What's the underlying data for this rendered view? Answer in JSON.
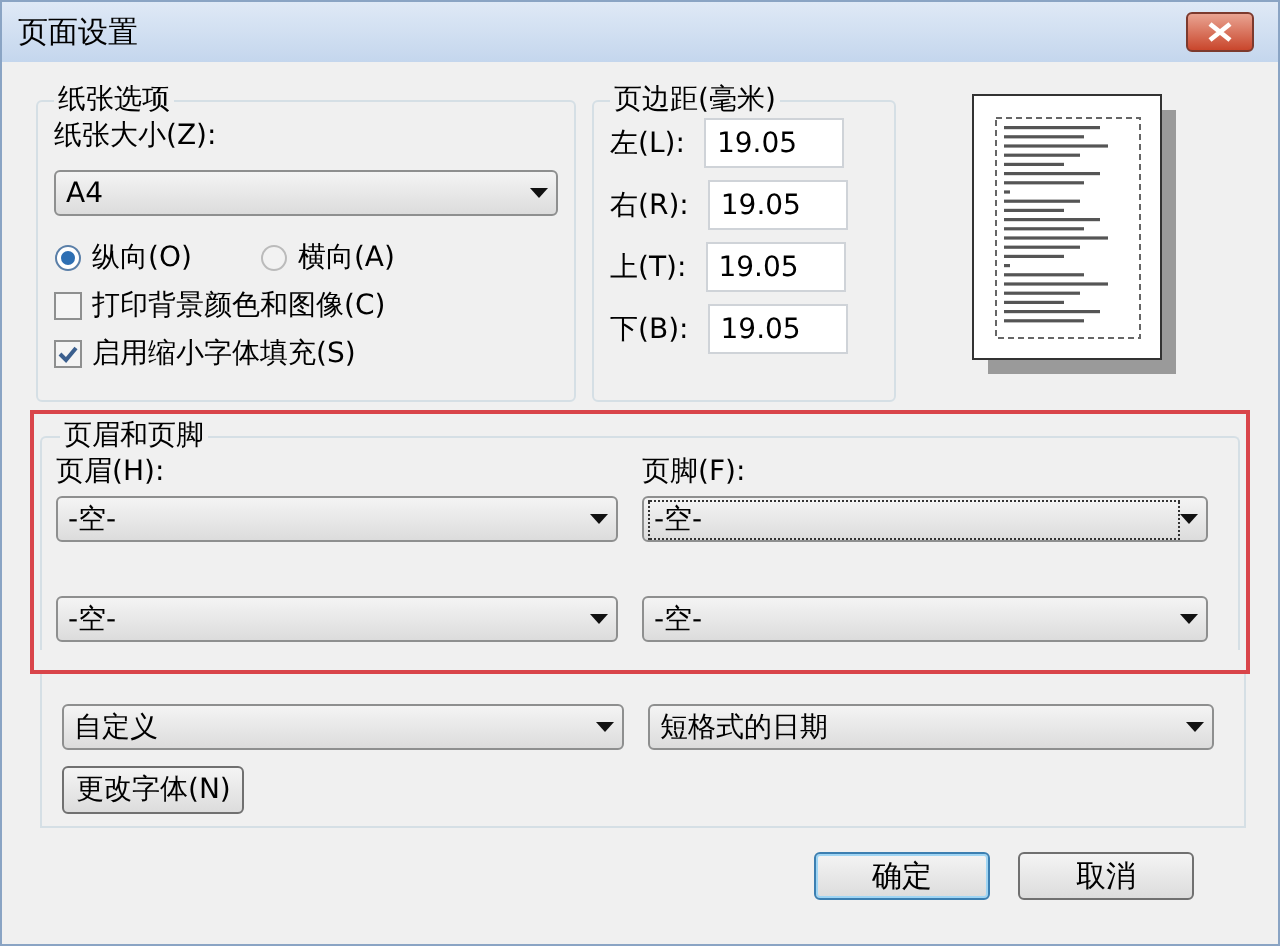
{
  "window": {
    "title": "页面设置"
  },
  "paper": {
    "title": "纸张选项",
    "size_label": "纸张大小(Z):",
    "size": "A4",
    "orientation": [
      {
        "label": "纵向(O)",
        "selected": true
      },
      {
        "label": "横向(A)",
        "selected": false
      }
    ],
    "options": [
      {
        "label": "打印背景颜色和图像(C)",
        "checked": false
      },
      {
        "label": "启用缩小字体填充(S)",
        "checked": true
      }
    ]
  },
  "margins": {
    "title": "页边距(毫米)",
    "fields": [
      {
        "label": "左(L):",
        "value": "19.05"
      },
      {
        "label": "右(R):",
        "value": "19.05"
      },
      {
        "label": "上(T):",
        "value": "19.05"
      },
      {
        "label": "下(B):",
        "value": "19.05"
      }
    ]
  },
  "header_footer": {
    "title": "页眉和页脚",
    "header_label": "页眉(H):",
    "footer_label": "页脚(F):",
    "rows": [
      {
        "header": {
          "value": "-空-",
          "focused": false
        },
        "footer": {
          "value": "-空-",
          "focused": true
        }
      },
      {
        "header": {
          "value": "-空-",
          "focused": false
        },
        "footer": {
          "value": "-空-",
          "focused": false
        }
      },
      {
        "header": {
          "value": "自定义",
          "focused": false
        },
        "footer": {
          "value": "短格式的日期",
          "focused": false
        }
      }
    ],
    "font_button": "更改字体(N)"
  },
  "buttons": [
    {
      "label": "确定",
      "default": true
    },
    {
      "label": "取消",
      "default": false
    }
  ]
}
